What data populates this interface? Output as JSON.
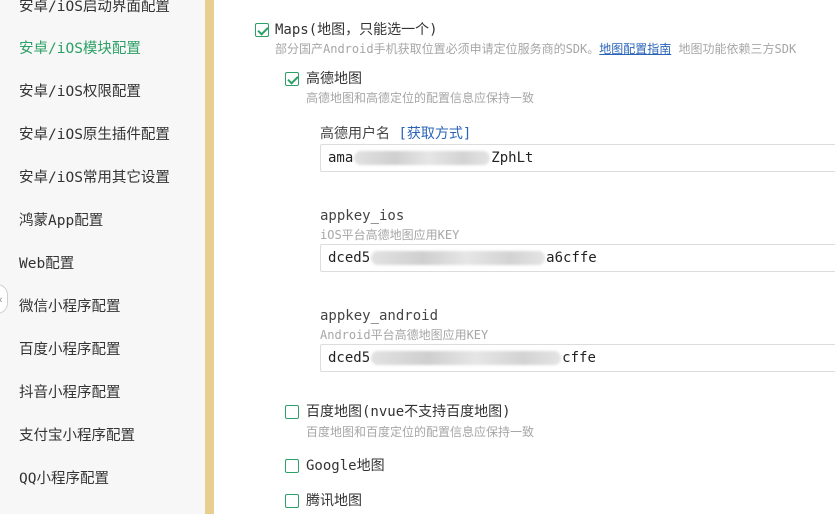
{
  "sidebar": {
    "items": [
      {
        "label": "安卓/iOS启动界面配置",
        "active": false
      },
      {
        "label": "安卓/iOS模块配置",
        "active": true
      },
      {
        "label": "安卓/iOS权限配置",
        "active": false
      },
      {
        "label": "安卓/iOS原生插件配置",
        "active": false
      },
      {
        "label": "安卓/iOS常用其它设置",
        "active": false
      },
      {
        "label": "鸿蒙App配置",
        "active": false
      },
      {
        "label": "Web配置",
        "active": false
      },
      {
        "label": "微信小程序配置",
        "active": false
      },
      {
        "label": "百度小程序配置",
        "active": false
      },
      {
        "label": "抖音小程序配置",
        "active": false
      },
      {
        "label": "支付宝小程序配置",
        "active": false
      },
      {
        "label": "QQ小程序配置",
        "active": false
      }
    ],
    "collapse_glyph": "‹"
  },
  "maps": {
    "label": "Maps(地图，只能选一个)",
    "checked": true,
    "desc": "部分国产Android手机获取位置必须申请定位服务商的SDK。",
    "desc_link": "地图配置指南",
    "desc_tail": "地图功能依赖三方SDK"
  },
  "amap": {
    "label": "高德地图",
    "checked": true,
    "desc": "高德地图和高德定位的配置信息应保持一致",
    "username": {
      "label": "高德用户名",
      "link": "[获取方式]",
      "value_prefix": "ama",
      "value_suffix": "ZphLt"
    },
    "appkey_ios": {
      "label": "appkey_ios",
      "desc": "iOS平台高德地图应用KEY",
      "value_prefix": "dced5",
      "value_suffix": "a6cffe"
    },
    "appkey_android": {
      "label": "appkey_android",
      "desc": "Android平台高德地图应用KEY",
      "value_prefix": "dced5",
      "value_suffix": "cffe"
    }
  },
  "baidu": {
    "label": "百度地图(nvue不支持百度地图)",
    "checked": false,
    "desc": "百度地图和百度定位的配置信息应保持一致"
  },
  "google": {
    "label": "Google地图",
    "checked": false
  },
  "tencent": {
    "label": "腾讯地图",
    "checked": false
  },
  "colors": {
    "accent": "#2ca066",
    "link": "#2a64b8",
    "divider": "#e8cf8f"
  }
}
